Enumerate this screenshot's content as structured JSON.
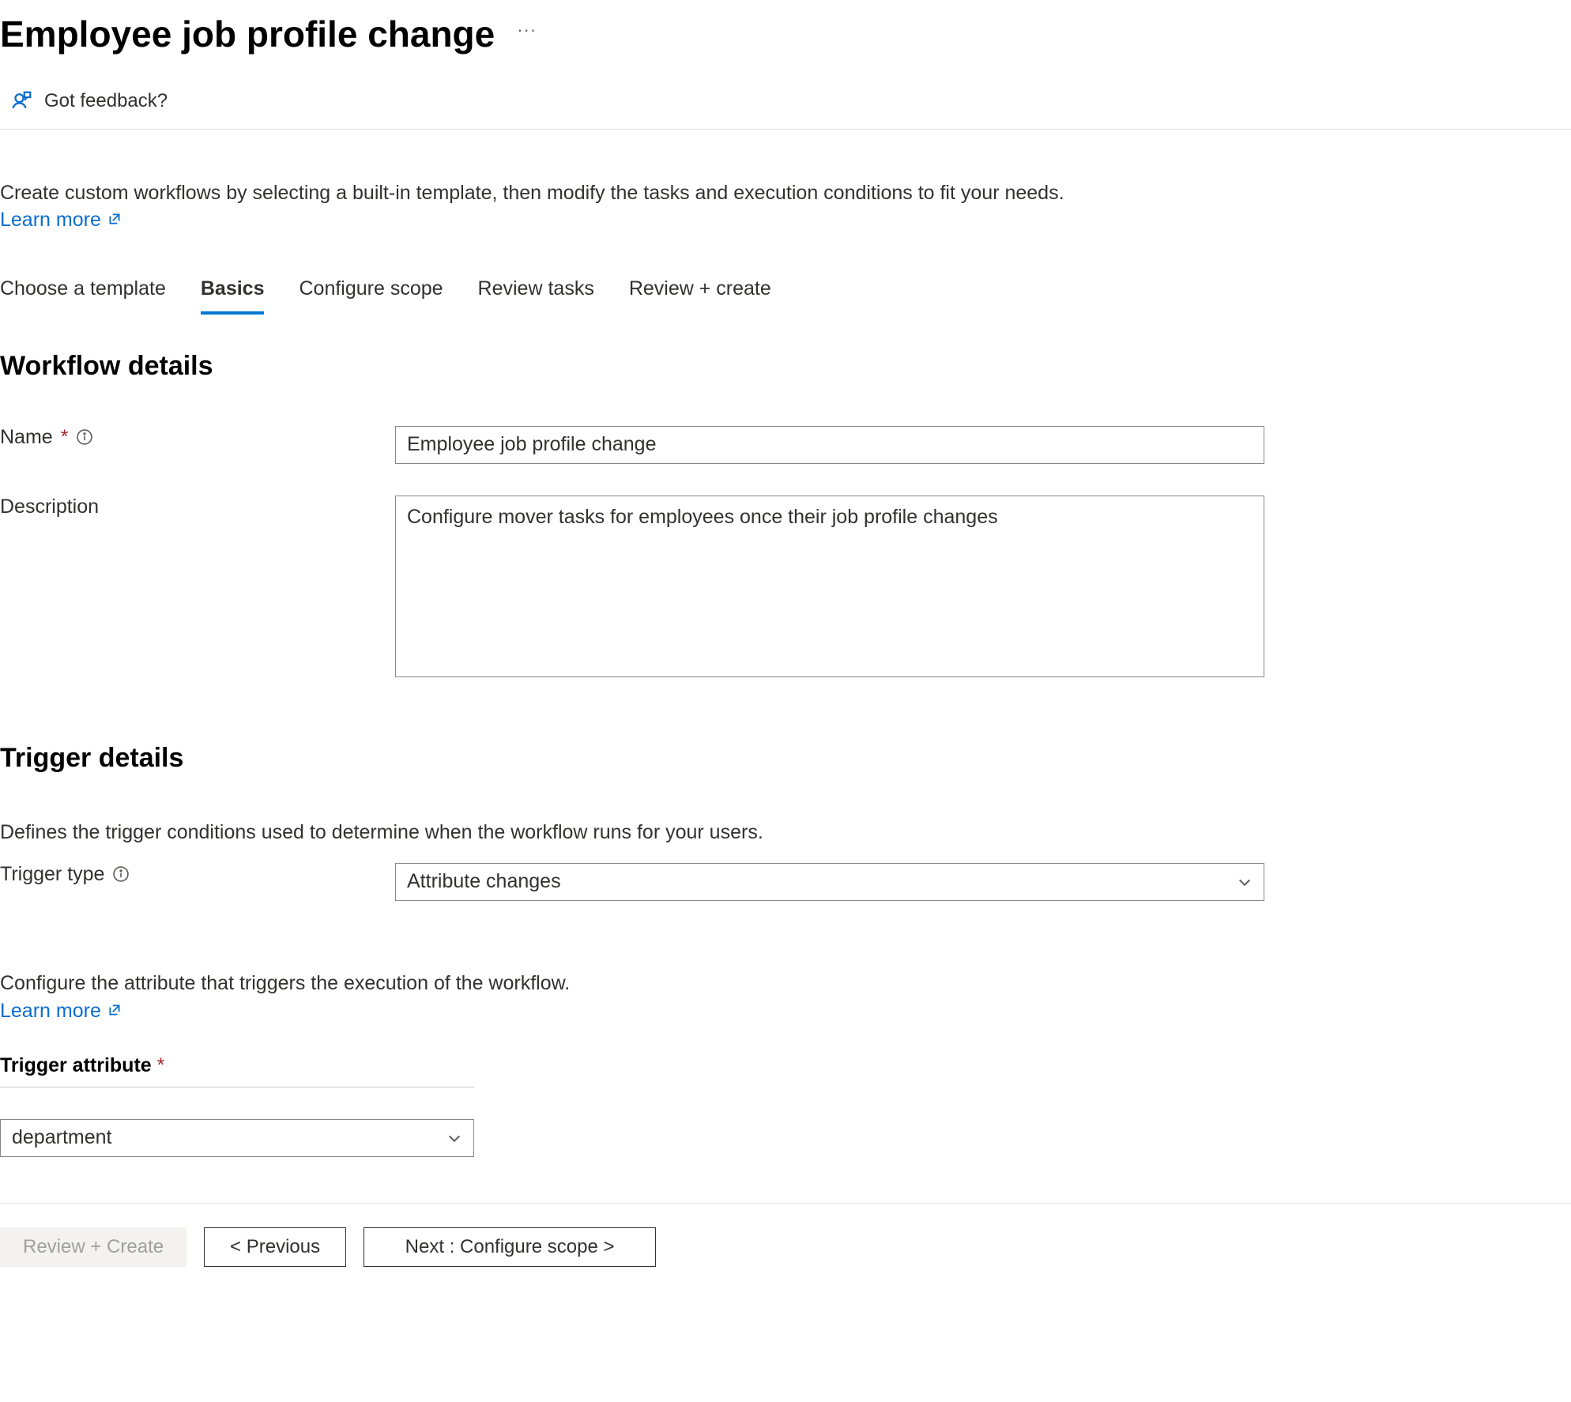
{
  "header": {
    "title": "Employee job profile change"
  },
  "toolbar": {
    "feedback_label": "Got feedback?"
  },
  "intro": {
    "text": "Create custom workflows by selecting a built-in template, then modify the tasks and execution conditions to fit your needs.",
    "learn_more": "Learn more"
  },
  "tabs": [
    {
      "label": "Choose a template",
      "active": false
    },
    {
      "label": "Basics",
      "active": true
    },
    {
      "label": "Configure scope",
      "active": false
    },
    {
      "label": "Review tasks",
      "active": false
    },
    {
      "label": "Review + create",
      "active": false
    }
  ],
  "workflow_details": {
    "section_title": "Workflow details",
    "name_label": "Name",
    "name_value": "Employee job profile change",
    "description_label": "Description",
    "description_value": "Configure mover tasks for employees once their job profile changes"
  },
  "trigger_details": {
    "section_title": "Trigger details",
    "description": "Defines the trigger conditions used to determine when the workflow runs for your users.",
    "trigger_type_label": "Trigger type",
    "trigger_type_value": "Attribute changes",
    "attribute_intro": "Configure the attribute that triggers the execution of the workflow.",
    "learn_more": "Learn more",
    "trigger_attribute_label": "Trigger attribute",
    "trigger_attribute_value": "department"
  },
  "footer": {
    "review_create": "Review + Create",
    "previous": "< Previous",
    "next": "Next : Configure scope >"
  }
}
